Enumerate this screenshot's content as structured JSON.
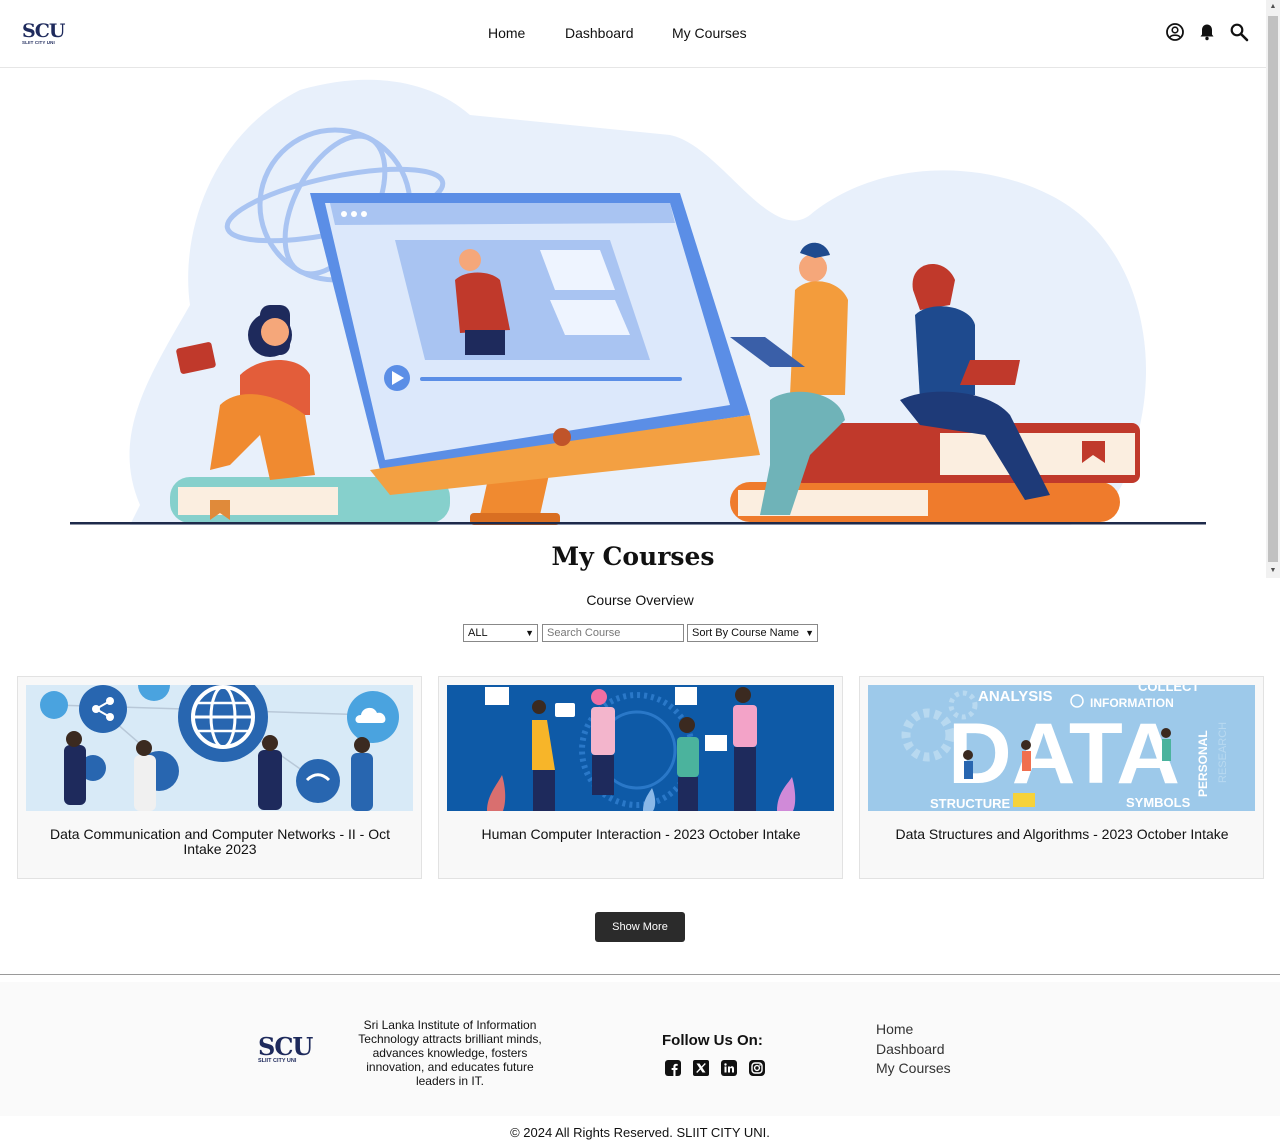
{
  "header": {
    "logo_text": "SCU",
    "logo_subtext": "SLIIT CITY UNI",
    "nav": [
      "Home",
      "Dashboard",
      "My Courses"
    ]
  },
  "icons": {
    "profile": "account-circle-icon",
    "notifications": "bell-icon",
    "search": "search-icon"
  },
  "main": {
    "title": "My Courses",
    "subtitle": "Course Overview",
    "filter_value": "ALL",
    "search_placeholder": "Search Course",
    "sort_value": "Sort By Course Name",
    "show_more_label": "Show More"
  },
  "courses": [
    {
      "title": "Data Communication and Computer Networks - II - Oct Intake 2023"
    },
    {
      "title": "Human Computer Interaction - 2023 October Intake"
    },
    {
      "title": "Data Structures and Algorithms - 2023 October Intake",
      "image_words": [
        "ANALYSIS",
        "COLLECT",
        "INFORMATION",
        "DATA",
        "STRUCTURE",
        "SYMBOLS",
        "PERSONAL",
        "RESEARCH"
      ]
    }
  ],
  "footer": {
    "logo_text": "SCU",
    "logo_subtext": "SLIIT CITY UNI",
    "description": "Sri Lanka Institute of Information Technology attracts brilliant minds, advances knowledge, fosters innovation, and educates future leaders in IT.",
    "follow_label": "Follow Us On:",
    "social": [
      "facebook-icon",
      "x-icon",
      "linkedin-icon",
      "instagram-icon"
    ],
    "links": [
      "Home",
      "Dashboard",
      "My Courses"
    ],
    "copyright": "© 2024 All Rights Reserved. SLIIT CITY UNI."
  },
  "colors": {
    "accent_dark": "#2b2b2b",
    "logo_navy": "#1e2a5c",
    "hero_blue": "#5b8ee6",
    "hero_orange": "#f08a30"
  }
}
